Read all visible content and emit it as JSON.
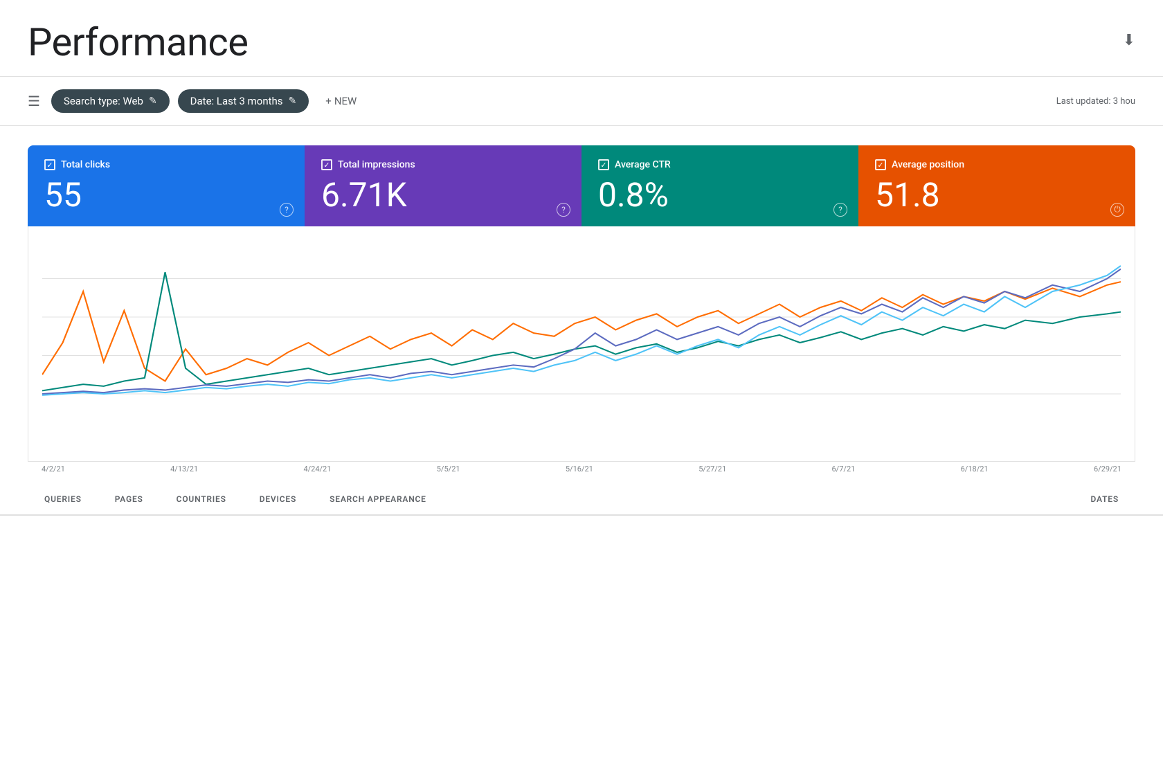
{
  "header": {
    "title": "Performance",
    "last_updated": "Last updated: 3 hou"
  },
  "toolbar": {
    "filter_label": "≡",
    "search_type_label": "Search type: Web",
    "date_label": "Date: Last 3 months",
    "new_label": "NEW",
    "edit_icon": "✎"
  },
  "metrics": [
    {
      "id": "total-clicks",
      "label": "Total clicks",
      "value": "55",
      "color": "blue"
    },
    {
      "id": "total-impressions",
      "label": "Total impressions",
      "value": "6.71K",
      "color": "purple"
    },
    {
      "id": "average-ctr",
      "label": "Average CTR",
      "value": "0.8%",
      "color": "teal"
    },
    {
      "id": "average-position",
      "label": "Average position",
      "value": "51.8",
      "color": "orange"
    }
  ],
  "chart": {
    "x_labels": [
      "4/2/21",
      "4/13/21",
      "4/24/21",
      "5/5/21",
      "5/16/21",
      "5/27/21",
      "6/7/21",
      "6/18/21",
      "6/29/21"
    ]
  },
  "bottom_tabs": [
    {
      "label": "QUERIES",
      "active": false
    },
    {
      "label": "PAGES",
      "active": false
    },
    {
      "label": "COUNTRIES",
      "active": false
    },
    {
      "label": "DEVICES",
      "active": false
    },
    {
      "label": "SEARCH APPEARANCE",
      "active": false
    },
    {
      "label": "DATES",
      "active": false
    }
  ],
  "icons": {
    "download": "⬇",
    "filter": "☰",
    "plus": "+",
    "edit": "✏",
    "question": "?"
  },
  "colors": {
    "blue": "#1a73e8",
    "purple": "#673ab7",
    "teal": "#00897b",
    "orange": "#e65100",
    "chart_blue": "#4285f4",
    "chart_orange": "#ff6d00",
    "chart_teal": "#00897b",
    "chart_purple": "#7c4dff"
  }
}
